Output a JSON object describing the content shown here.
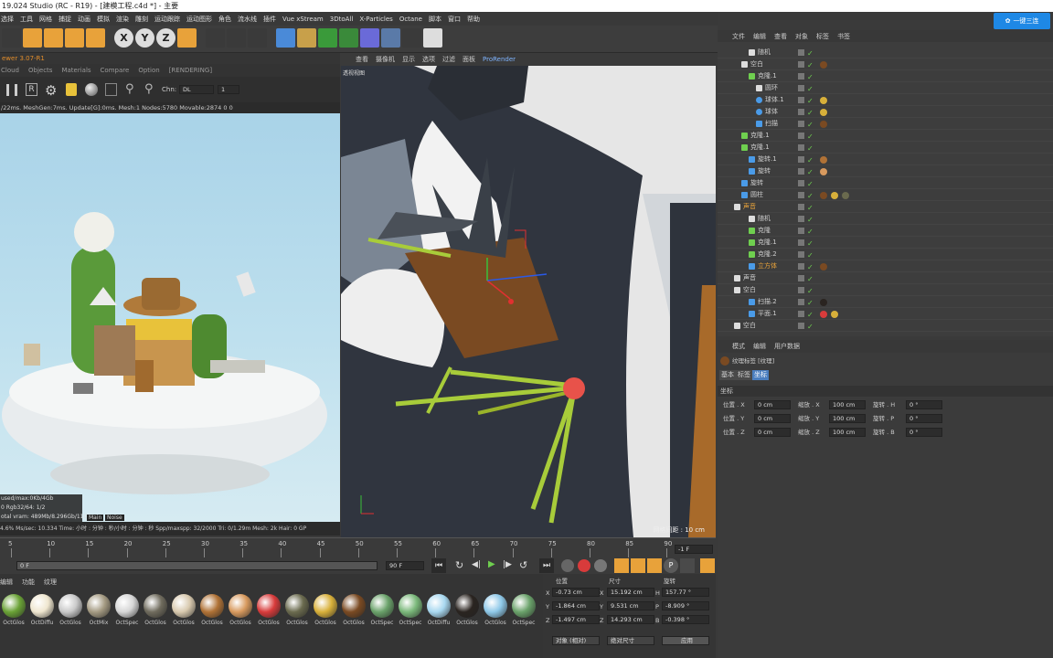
{
  "window": {
    "title": "19.024 Studio (RC - R19) - [建模工程.c4d *] - 主要"
  },
  "menu": [
    "选择",
    "工具",
    "网格",
    "捕捉",
    "动画",
    "模拟",
    "渲染",
    "雕刻",
    "运动跟踪",
    "运动图形",
    "角色",
    "流水线",
    "插件",
    "Vue xStream",
    "3DtoAll",
    "X-Particles",
    "Octane",
    "脚本",
    "窗口",
    "帮助"
  ],
  "toolbar_icons": [
    "cursor-icon",
    "move-icon",
    "scale-icon",
    "rotate-icon",
    "transform-icon",
    "x-axis-icon",
    "y-axis-icon",
    "z-axis-icon",
    "coordinate-icon",
    "render-region-icon",
    "render-view-icon",
    "render-settings-icon",
    "cube-icon",
    "pen-icon",
    "subdivision-icon",
    "cloner-icon",
    "deformer-icon",
    "floor-icon",
    "camera-icon",
    "light-icon"
  ],
  "axis_labels": [
    "X",
    "Y",
    "Z"
  ],
  "banner": {
    "label": "一键三连"
  },
  "live_viewer": {
    "title": "ewer 3.07-R1",
    "tabs": [
      "Cloud",
      "Objects",
      "Materials",
      "Compare",
      "Option",
      "[RENDERING]"
    ],
    "channel_label": "Chn:",
    "channel_value": "DL",
    "channel_num": "1",
    "stats": "/22ms. MeshGen:7ms. Update[G]:0ms. Mesh:1 Nodes:5780 Movable:2874  0 0",
    "mem_lines": [
      "used/max:0Kb/4Gb",
      "0        Rgb32/64: 1/2",
      "otal vram: 489Mb/8.296Gb/11G"
    ],
    "mode_tabs": [
      "Main",
      "Noise"
    ],
    "bottom": "4.6%    Ms/sec: 10.334   Time: 小时 : 分钟 : 秒/小时 : 分钟 : 秒   Spp/maxspp: 32/2000    Tri: 0/1.29m    Mesh: 2k    Hair: 0    GP"
  },
  "viewport": {
    "menu": [
      "查看",
      "摄像机",
      "显示",
      "选项",
      "过滤",
      "面板",
      "ProRender"
    ],
    "corner_label": "透视视图",
    "grid_label": "网格间距 : 10 cm"
  },
  "timeline": {
    "ticks": [
      "5",
      "10",
      "15",
      "20",
      "25",
      "30",
      "35",
      "40",
      "45",
      "50",
      "55",
      "60",
      "65",
      "70",
      "75",
      "80",
      "85",
      "90"
    ],
    "frame_field": "-1 F",
    "start_field": "0 F",
    "end_field": "90 F",
    "end_field2": "90 F"
  },
  "materials": {
    "tabs": [
      "编辑",
      "功能",
      "纹理"
    ],
    "items": [
      {
        "name": "OctGlos",
        "color": "#6aa236"
      },
      {
        "name": "OctDiffu",
        "color": "#efe6cf"
      },
      {
        "name": "OctGlos",
        "color": "#c9c9c9"
      },
      {
        "name": "OctMix",
        "color": "#a49a82"
      },
      {
        "name": "OctSpec",
        "color": "#d6d6d6"
      },
      {
        "name": "OctGlos",
        "color": "#6f6b5d"
      },
      {
        "name": "OctGlos",
        "color": "#d8c9ae"
      },
      {
        "name": "OctGlos",
        "color": "#b07236"
      },
      {
        "name": "OctGlos",
        "color": "#d89a5e"
      },
      {
        "name": "OctGlos",
        "color": "#d83b3b"
      },
      {
        "name": "OctGlos",
        "color": "#6a6a4e"
      },
      {
        "name": "OctGlos",
        "color": "#d8b03a"
      },
      {
        "name": "OctGlos",
        "color": "#7a4a22"
      },
      {
        "name": "OctSpec",
        "color": "#6aa26a"
      },
      {
        "name": "OctSpec",
        "color": "#7ab87a"
      },
      {
        "name": "OctDiffu",
        "color": "#a8d8f0"
      },
      {
        "name": "OctGlos",
        "color": "#2a2420"
      },
      {
        "name": "OctGlos",
        "color": "#8ec8e8"
      },
      {
        "name": "OctSpec",
        "color": "#6aa26a"
      }
    ]
  },
  "coords": {
    "headers": [
      "位置",
      "尺寸",
      "旋转"
    ],
    "rows": [
      {
        "axis": "X",
        "pos": "-0.73 cm",
        "size": "15.192 cm",
        "rot_label": "H",
        "rot": "157.77 °"
      },
      {
        "axis": "Y",
        "pos": "-1.864 cm",
        "size": "9.531 cm",
        "rot_label": "P",
        "rot": "-8.909 °"
      },
      {
        "axis": "Z",
        "pos": "-1.497 cm",
        "size": "14.293 cm",
        "rot_label": "B",
        "rot": "-0.398 °"
      }
    ],
    "mode1": "对象 (相对)",
    "mode2": "绝对尺寸",
    "apply": "应用"
  },
  "object_manager": {
    "menu": [
      "文件",
      "编辑",
      "查看",
      "对象",
      "标签",
      "书签"
    ],
    "rows": [
      {
        "indent": 2,
        "icon": "random",
        "label": "随机",
        "color": "#ccc",
        "tags": []
      },
      {
        "indent": 1,
        "icon": "null",
        "label": "空白",
        "color": "#ccc",
        "tags": [
          "#7a4a22"
        ]
      },
      {
        "indent": 2,
        "icon": "cloner",
        "label": "克隆.1",
        "color": "#ccc",
        "tags": []
      },
      {
        "indent": 3,
        "icon": "spline",
        "label": "圆环",
        "color": "#ccc",
        "tags": []
      },
      {
        "indent": 3,
        "icon": "sphere",
        "label": "球体.1",
        "color": "#ccc",
        "tags": [
          "#d8b03a"
        ]
      },
      {
        "indent": 3,
        "icon": "sphere",
        "label": "球体",
        "color": "#ccc",
        "tags": [
          "#d8b03a"
        ]
      },
      {
        "indent": 3,
        "icon": "sweep",
        "label": "扫描",
        "color": "#ccc",
        "tags": [
          "#7a4a22"
        ]
      },
      {
        "indent": 1,
        "icon": "cloner",
        "label": "克隆.1",
        "color": "#ccc",
        "tags": []
      },
      {
        "indent": 1,
        "icon": "cloner",
        "label": "克隆.1",
        "color": "#ccc",
        "tags": []
      },
      {
        "indent": 2,
        "icon": "lathe",
        "label": "旋转.1",
        "color": "#ccc",
        "tags": [
          "#b07236"
        ]
      },
      {
        "indent": 2,
        "icon": "lathe",
        "label": "旋转",
        "color": "#ccc",
        "tags": [
          "#d89a5e"
        ]
      },
      {
        "indent": 1,
        "icon": "lathe",
        "label": "旋转",
        "color": "#ccc",
        "tags": []
      },
      {
        "indent": 1,
        "icon": "cylinder",
        "label": "圆柱",
        "color": "#ccc",
        "tags": [
          "#7a4a22",
          "#d8b03a",
          "#6a6a4e"
        ]
      },
      {
        "indent": 0,
        "icon": "null",
        "label": "声音",
        "color": "#e8a23a",
        "tags": []
      },
      {
        "indent": 2,
        "icon": "random",
        "label": "随机",
        "color": "#ccc",
        "tags": []
      },
      {
        "indent": 2,
        "icon": "cloner",
        "label": "克隆",
        "color": "#ccc",
        "tags": []
      },
      {
        "indent": 2,
        "icon": "cloner",
        "label": "克隆.1",
        "color": "#ccc",
        "tags": []
      },
      {
        "indent": 2,
        "icon": "cloner",
        "label": "克隆.2",
        "color": "#ccc",
        "tags": []
      },
      {
        "indent": 2,
        "icon": "cube",
        "label": "立方体",
        "color": "#e8a23a",
        "tags": [
          "#7a4a22"
        ]
      },
      {
        "indent": 0,
        "icon": "null",
        "label": "声音",
        "color": "#ccc",
        "tags": []
      },
      {
        "indent": 0,
        "icon": "null",
        "label": "空白",
        "color": "#ccc",
        "tags": []
      },
      {
        "indent": 2,
        "icon": "sweep",
        "label": "扫描.2",
        "color": "#ccc",
        "tags": [
          "#2a2420"
        ]
      },
      {
        "indent": 2,
        "icon": "plane",
        "label": "平面.1",
        "color": "#ccc",
        "tags": [
          "#d83b3b",
          "#d8b03a"
        ]
      },
      {
        "indent": 0,
        "icon": "null",
        "label": "空白",
        "color": "#ccc",
        "tags": []
      }
    ]
  },
  "attributes": {
    "menu": [
      "模式",
      "编辑",
      "用户数据"
    ],
    "title": "纹理标签 [纹理]",
    "tabs": [
      "基本",
      "标签",
      "坐标"
    ],
    "section": "坐标",
    "rows": [
      {
        "pos_label": "位置 . X",
        "pos": "0 cm",
        "scale_label": "缩放 . X",
        "scale": "100 cm",
        "rot_label": "旋转 . H",
        "rot": "0 °"
      },
      {
        "pos_label": "位置 . Y",
        "pos": "0 cm",
        "scale_label": "缩放 . Y",
        "scale": "100 cm",
        "rot_label": "旋转 . P",
        "rot": "0 °"
      },
      {
        "pos_label": "位置 . Z",
        "pos": "0 cm",
        "scale_label": "缩放 . Z",
        "scale": "100 cm",
        "rot_label": "旋转 . B",
        "rot": "0 °"
      }
    ]
  },
  "colors": {
    "accent": "#4a9be8",
    "orange": "#e8a23a",
    "check": "#6fcf4f"
  }
}
